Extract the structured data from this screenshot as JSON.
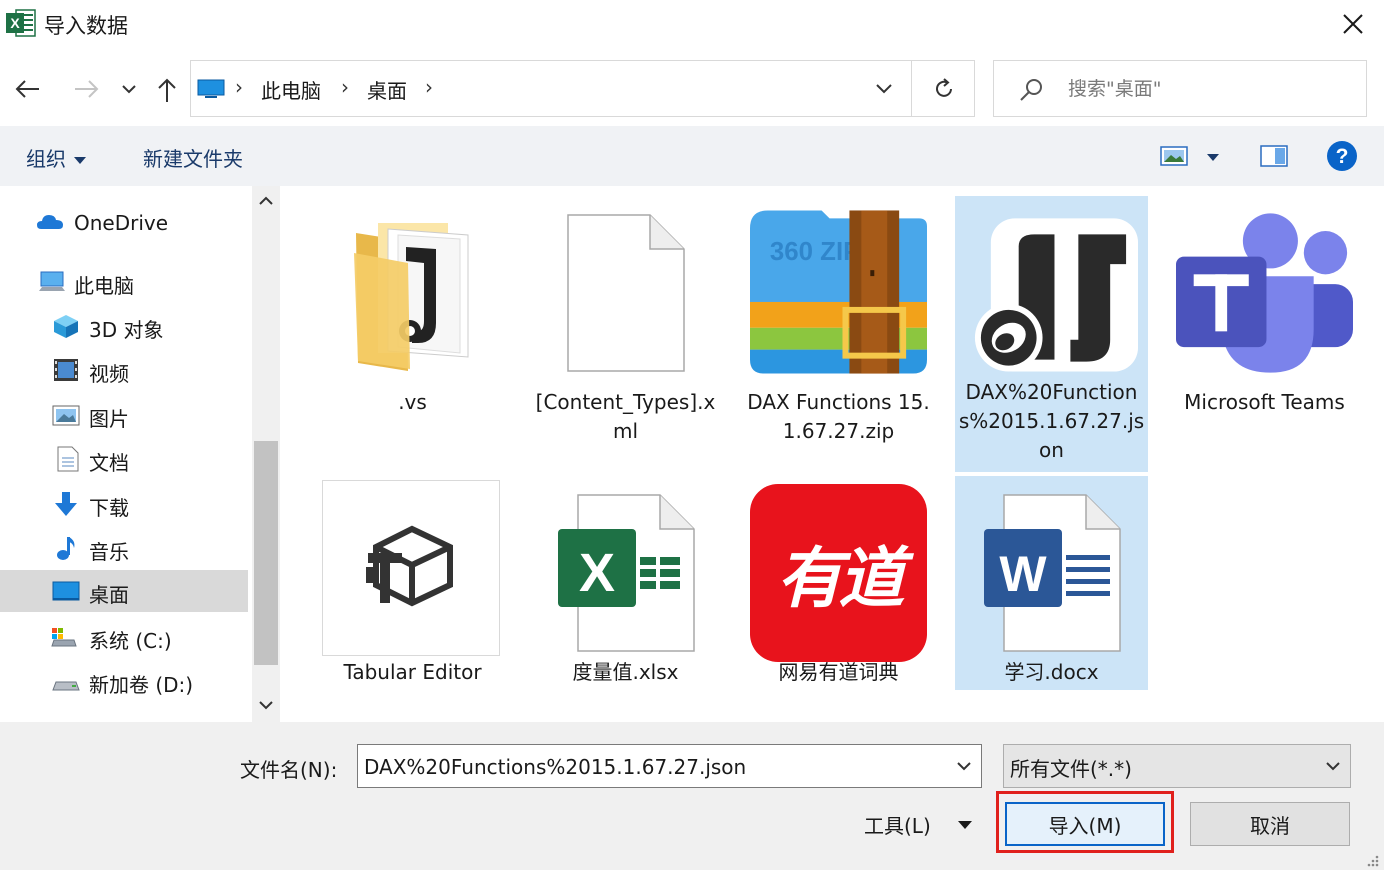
{
  "window": {
    "title": "导入数据",
    "app_icon": "excel-icon"
  },
  "nav": {
    "breadcrumbs": [
      "此电脑",
      "桌面"
    ],
    "search_placeholder": "搜索\"桌面\""
  },
  "toolbar": {
    "organize_label": "组织",
    "new_folder_label": "新建文件夹"
  },
  "sidebar": {
    "items": [
      {
        "label": "OneDrive",
        "icon": "cloud-icon"
      },
      {
        "label": "此电脑",
        "icon": "computer-icon"
      },
      {
        "label": "3D 对象",
        "icon": "cube-icon"
      },
      {
        "label": "视频",
        "icon": "video-icon"
      },
      {
        "label": "图片",
        "icon": "picture-icon"
      },
      {
        "label": "文档",
        "icon": "document-icon"
      },
      {
        "label": "下载",
        "icon": "download-icon"
      },
      {
        "label": "音乐",
        "icon": "music-icon"
      },
      {
        "label": "桌面",
        "icon": "desktop-icon",
        "active": true
      },
      {
        "label": "系统 (C:)",
        "icon": "drive-system-icon"
      },
      {
        "label": "新加卷 (D:)",
        "icon": "drive-icon"
      }
    ]
  },
  "files": [
    {
      "name": ".vs",
      "icon": "folder-icon",
      "selected": false
    },
    {
      "name": "[Content_Types].xml",
      "icon": "blank-file-icon",
      "selected": false
    },
    {
      "name": "DAX Functions 15.1.67.27.zip",
      "icon": "zip-archive-icon",
      "selected": false
    },
    {
      "name": "DAX%20Functions%2015.1.67.27.json",
      "icon": "json-file-icon",
      "selected": true
    },
    {
      "name": "Microsoft Teams",
      "icon": "teams-icon",
      "selected": false
    },
    {
      "name": "Tabular Editor",
      "icon": "tabular-editor-icon",
      "selected": false
    },
    {
      "name": "度量值.xlsx",
      "icon": "excel-file-icon",
      "selected": false
    },
    {
      "name": "网易有道词典",
      "icon": "youdao-icon",
      "selected": false
    },
    {
      "name": "学习.docx",
      "icon": "word-file-icon",
      "selected": true
    }
  ],
  "youdao_logo_text": "有道",
  "zip_logo_text": "360 ZIP",
  "footer": {
    "filename_label": "文件名(N):",
    "filename_value": "DAX%20Functions%2015.1.67.27.json",
    "filter_value": "所有文件(*.*)",
    "tools_label": "工具(L)",
    "import_label": "导入(M)",
    "cancel_label": "取消"
  },
  "colors": {
    "accent": "#0a64c8",
    "selection": "#cce4f7",
    "highlight_box": "#e0201c",
    "excel_green": "#1e7145",
    "word_blue": "#2b5797",
    "youdao_red": "#e8131c",
    "teams_purple": "#5059c9"
  }
}
